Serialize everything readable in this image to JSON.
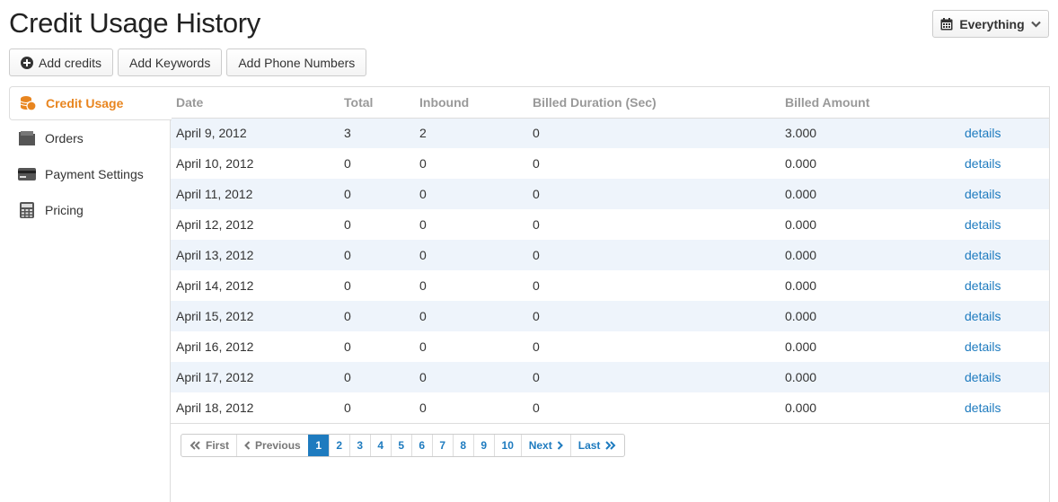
{
  "title": "Credit Usage History",
  "filter": {
    "label": "Everything"
  },
  "actions": {
    "add_credits": "Add credits",
    "add_keywords": "Add Keywords",
    "add_phone_numbers": "Add Phone Numbers"
  },
  "sidebar": {
    "items": [
      {
        "label": "Credit Usage",
        "icon": "coins-icon",
        "active": true
      },
      {
        "label": "Orders",
        "icon": "folder-icon",
        "active": false
      },
      {
        "label": "Payment Settings",
        "icon": "credit-card-icon",
        "active": false
      },
      {
        "label": "Pricing",
        "icon": "calculator-icon",
        "active": false
      }
    ]
  },
  "table": {
    "headers": [
      "Date",
      "Total",
      "Inbound",
      "Billed Duration (Sec)",
      "Billed Amount"
    ],
    "rows": [
      {
        "date": "April 9, 2012",
        "total": "3",
        "inbound": "2",
        "duration": "0",
        "amount": "3.000",
        "link": "details"
      },
      {
        "date": "April 10, 2012",
        "total": "0",
        "inbound": "0",
        "duration": "0",
        "amount": "0.000",
        "link": "details"
      },
      {
        "date": "April 11, 2012",
        "total": "0",
        "inbound": "0",
        "duration": "0",
        "amount": "0.000",
        "link": "details"
      },
      {
        "date": "April 12, 2012",
        "total": "0",
        "inbound": "0",
        "duration": "0",
        "amount": "0.000",
        "link": "details"
      },
      {
        "date": "April 13, 2012",
        "total": "0",
        "inbound": "0",
        "duration": "0",
        "amount": "0.000",
        "link": "details"
      },
      {
        "date": "April 14, 2012",
        "total": "0",
        "inbound": "0",
        "duration": "0",
        "amount": "0.000",
        "link": "details"
      },
      {
        "date": "April 15, 2012",
        "total": "0",
        "inbound": "0",
        "duration": "0",
        "amount": "0.000",
        "link": "details"
      },
      {
        "date": "April 16, 2012",
        "total": "0",
        "inbound": "0",
        "duration": "0",
        "amount": "0.000",
        "link": "details"
      },
      {
        "date": "April 17, 2012",
        "total": "0",
        "inbound": "0",
        "duration": "0",
        "amount": "0.000",
        "link": "details"
      },
      {
        "date": "April 18, 2012",
        "total": "0",
        "inbound": "0",
        "duration": "0",
        "amount": "0.000",
        "link": "details"
      }
    ]
  },
  "pagination": {
    "first": "First",
    "previous": "Previous",
    "pages": [
      "1",
      "2",
      "3",
      "4",
      "5",
      "6",
      "7",
      "8",
      "9",
      "10"
    ],
    "current": "1",
    "next": "Next",
    "last": "Last"
  },
  "colors": {
    "accent": "#e8851f",
    "link": "#1e7bbf",
    "row_stripe": "#eef4fb"
  }
}
